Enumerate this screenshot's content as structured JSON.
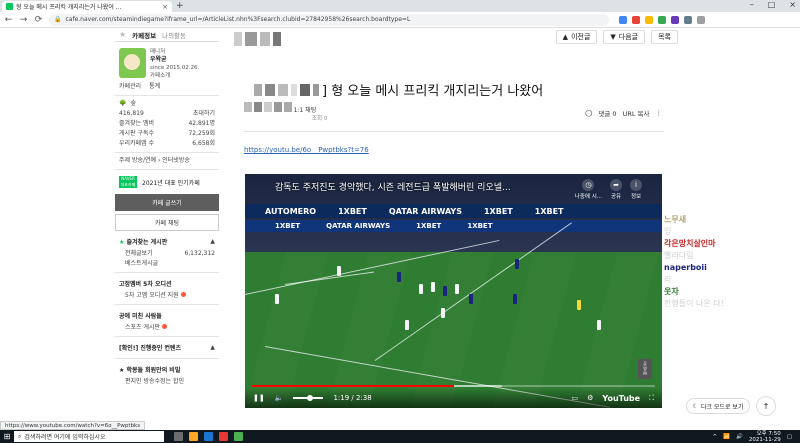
{
  "browser": {
    "tab_title": "형 오늘 메시 프리킥 개지리는거 나왔어 ...",
    "tab_close": "×",
    "new_tab": "+",
    "url": "cafe.naver.com/steamindiegame?iframe_url=/ArticleList.nhn%3Fsearch.clubid=27842958%26search.boardtype=L",
    "win_min": "–",
    "win_max": "□",
    "win_close": "×"
  },
  "topnav": {
    "prev": "이전글",
    "next": "다음글",
    "list": "목록"
  },
  "sidebar": {
    "tab_cafe_info": "카페정보",
    "tab_my_activity": "나의활동",
    "manager_label": "매니저",
    "manager_name": "우왁굳",
    "since": "since 2015.02.26.",
    "cafe_intro": "카페소개",
    "cafe_manage": "카페관리",
    "stats": "통계",
    "grade": "숲",
    "members": "416,819",
    "invite": "초대하기",
    "fav_members_label": "즐겨찾는 멤버",
    "fav_members_value": "42,891명",
    "subscribers_label": "게시판 구독수",
    "subscribers_value": "72,259회",
    "cafe_exposure_label": "우리카페앱 수",
    "cafe_exposure_value": "6,658회",
    "topic": "주제  방송/연예 › 인터넷방송",
    "award_badge": "NAVER 대표카페",
    "award_text": "2021년 대표 인기카페",
    "write_button": "카페 글쓰기",
    "chat_button": "카페 채팅",
    "fav_boards_title": "즐겨찾는 게시판",
    "boards": [
      {
        "name": "전체글보기",
        "count": "6,132,312"
      },
      {
        "name": "베스트게시글",
        "count": ""
      }
    ],
    "board_groups": [
      "고정멤버 5차 오디션",
      "5차 고멤 오디션 지원",
      "공에 미친 사람들",
      "스포츠 게시판",
      "[확인!] 진행중인 컨텐츠",
      "학몽들 회원만의 비밀",
      "편지민 방송수정는 합인"
    ]
  },
  "article": {
    "title": "] 형 오늘 메시 프리킥 개지리는거 나왔어",
    "level": "1:1 채팅",
    "views": "조회 0",
    "comments": "댓글 0",
    "url_copy": "URL 복사",
    "link": "https://youtu.be/6o__Pwptbks?t=76"
  },
  "video": {
    "title": "감독도 주저진도 경악했다, 시즌 레전드급 폭발해버린 리오넬...",
    "later": "나중에 시...",
    "share": "공유",
    "info": "정보",
    "boards_top": [
      "AUTOMERO",
      "1XBET",
      "QATAR AIRWAYS",
      "1XBET",
      "1XBET"
    ],
    "boards_bottom": [
      "1XBET",
      "QATAR AIRWAYS",
      "1XBET",
      "1XBET"
    ],
    "time": "1:19 / 2:38",
    "brand": "YouTube",
    "progress": 0.5,
    "buffer": 0.62
  },
  "chat": [
    {
      "name": "느무새",
      "color": "#b0a070",
      "msg": "잉"
    },
    {
      "name": "각은망치살인마",
      "color": "#c62828",
      "msg": "빨리다림"
    },
    {
      "name": "naperboii",
      "color": "#1a237e",
      "msg": "리"
    },
    {
      "name": "웃자",
      "color": "#2e7d32",
      "msg": "칸행들이 나온 다!"
    }
  ],
  "dark_mode": "다크 모드로 보기",
  "status_url": "https://www.youtube.com/watch?v=6o__Pwptbks",
  "taskbar": {
    "search": "검색하려면 여기에 입력하십시오",
    "time": "오후 7:50",
    "date": "2021-11-29"
  },
  "colors": {
    "naver_green": "#03c75a",
    "link_blue": "#2e63b8",
    "pitch": "#2e7d32",
    "progress_red": "#ff0000"
  }
}
